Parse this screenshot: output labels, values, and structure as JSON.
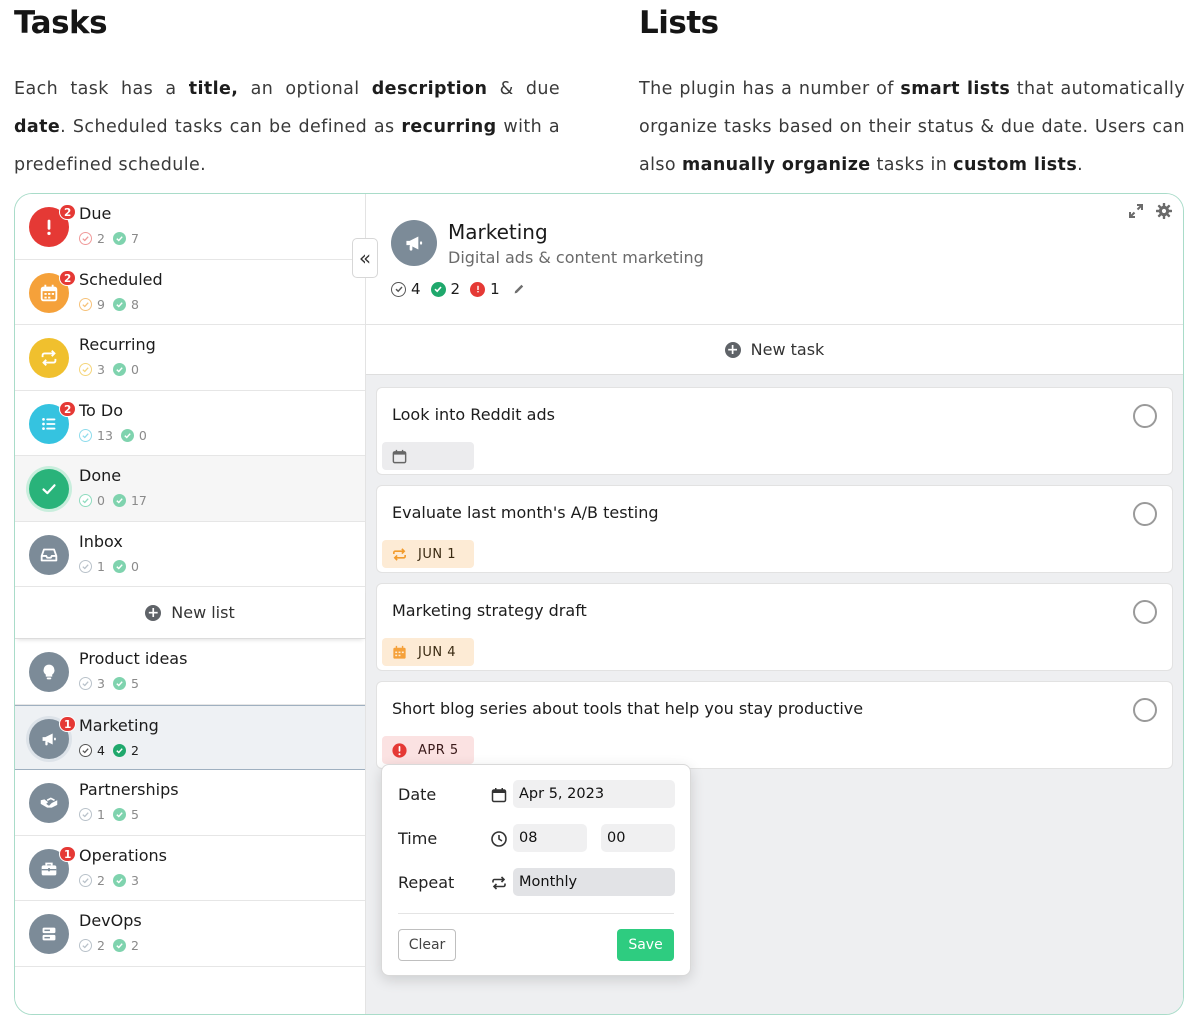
{
  "intro": {
    "tasks": {
      "heading": "Tasks",
      "p1": "Each task has a ",
      "b1": "title,",
      "p2": " an optional ",
      "b2": "description",
      "p3": " & due ",
      "b3": "date",
      "p4": ". Scheduled tasks can be defined as ",
      "b4": "recurring",
      "p5": " with a predefined schedule."
    },
    "lists": {
      "heading": "Lists",
      "p1": "The plugin has a number of ",
      "b1": "smart lists",
      "p2": " that automatically organize tasks based on their status & due date. Users can also ",
      "b2": "manually organize",
      "p3": " tasks in ",
      "b3": "custom lists",
      "p4": "."
    }
  },
  "sidebar": {
    "smart_lists": [
      {
        "name": "Due",
        "badge": "2",
        "open": "2",
        "done": "7",
        "color": "#e53935",
        "icon": "exclamation-icon"
      },
      {
        "name": "Scheduled",
        "badge": "2",
        "open": "9",
        "done": "8",
        "color": "#f5a13a",
        "icon": "calendar-icon"
      },
      {
        "name": "Recurring",
        "badge": "",
        "open": "3",
        "done": "0",
        "color": "#f0c02e",
        "icon": "repeat-icon"
      },
      {
        "name": "To Do",
        "badge": "2",
        "open": "13",
        "done": "0",
        "color": "#35c3e0",
        "icon": "list-icon"
      },
      {
        "name": "Done",
        "badge": "",
        "open": "0",
        "done": "17",
        "color": "#29b37a",
        "icon": "check-icon"
      },
      {
        "name": "Inbox",
        "badge": "",
        "open": "1",
        "done": "0",
        "color": "#7c8b98",
        "icon": "inbox-icon"
      }
    ],
    "new_list_label": "New list",
    "custom_lists": [
      {
        "name": "Product ideas",
        "badge": "",
        "open": "3",
        "done": "5",
        "icon": "lightbulb-icon"
      },
      {
        "name": "Marketing",
        "badge": "1",
        "open": "4",
        "done": "2",
        "icon": "megaphone-icon"
      },
      {
        "name": "Partnerships",
        "badge": "",
        "open": "1",
        "done": "5",
        "icon": "handshake-icon"
      },
      {
        "name": "Operations",
        "badge": "1",
        "open": "2",
        "done": "3",
        "icon": "briefcase-icon"
      },
      {
        "name": "DevOps",
        "badge": "",
        "open": "2",
        "done": "2",
        "icon": "server-icon"
      }
    ],
    "collapse_glyph": "«"
  },
  "main": {
    "title": "Marketing",
    "subtitle": "Digital ads & content marketing",
    "count_open": "4",
    "count_done": "2",
    "count_due": "1",
    "new_task_label": "New task",
    "tasks": [
      {
        "title": "Look into Reddit ads",
        "chip": ""
      },
      {
        "title": "Evaluate last month's A/B testing",
        "chip": "JUN 1"
      },
      {
        "title": "Marketing strategy draft",
        "chip": "JUN 4"
      },
      {
        "title": "Short blog series about tools that help you stay productive",
        "chip": "APR 5"
      }
    ]
  },
  "popover": {
    "date_label": "Date",
    "date_value": "Apr 5, 2023",
    "time_label": "Time",
    "hour": "08",
    "minute": "00",
    "colon": ":",
    "repeat_label": "Repeat",
    "repeat_value": "Monthly",
    "clear_label": "Clear",
    "save_label": "Save"
  },
  "colors": {
    "accent_green": "#2ecc80",
    "badge_red": "#e53935",
    "neutral_icon": "#7c8b98",
    "frame_border": "#a9dcc9"
  }
}
